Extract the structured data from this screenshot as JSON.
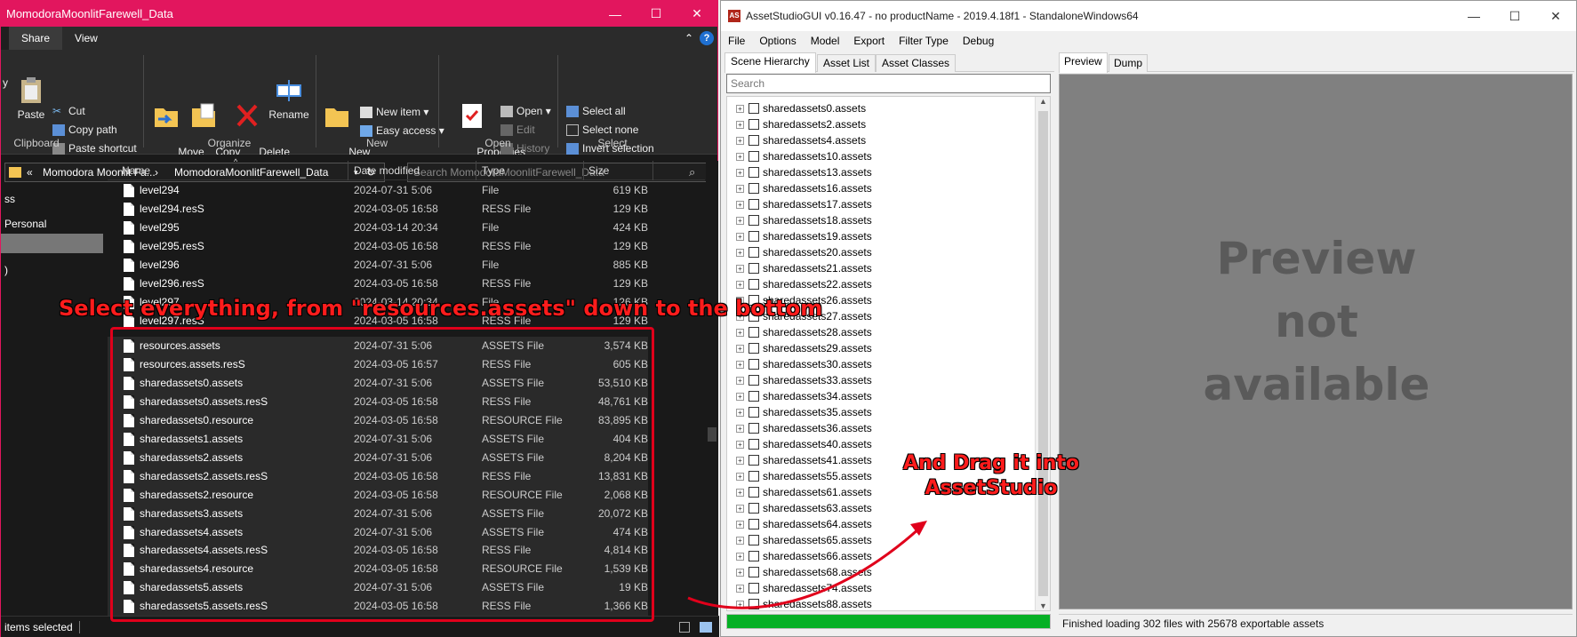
{
  "explorer": {
    "title": "MomodoraMoonlitFarewell_Data",
    "window_buttons": {
      "minimize": "—",
      "maximize": "☐",
      "close": "✕"
    },
    "tabs": [
      "Share",
      "View"
    ],
    "help": "?",
    "ribbon": {
      "clipboard": {
        "group": "Clipboard",
        "paste": "Paste",
        "cut": "Cut",
        "copy_path": "Copy path",
        "paste_shortcut": "Paste shortcut",
        "partial_left": "y"
      },
      "organize": {
        "group": "Organize",
        "move_to": "Move\nto ▾",
        "copy_to": "Copy\nto ▾",
        "delete": "Delete\n▾",
        "rename": "Rename"
      },
      "new": {
        "group": "New",
        "new_folder": "New\nfolder",
        "new_item": "New item ▾",
        "easy_access": "Easy access ▾"
      },
      "open": {
        "group": "Open",
        "properties": "Properties\n▾",
        "open": "Open ▾",
        "edit": "Edit",
        "history": "History"
      },
      "select": {
        "group": "Select",
        "select_all": "Select all",
        "select_none": "Select none",
        "invert": "Invert selection"
      }
    },
    "breadcrumb": {
      "prefix": "«",
      "part1": "Momodora Moonlit Fa...",
      "part2": "MomodoraMoonlitFarewell_Data"
    },
    "search_placeholder": "Search MomodoraMoonlitFarewell_Data",
    "nav": {
      "item1": "ss",
      "item2": "Personal",
      "item3": ")"
    },
    "columns": {
      "name": "Name",
      "date": "Date modified",
      "type": "Type",
      "size": "Size"
    },
    "files": [
      {
        "name": "level294",
        "date": "2024-07-31 5:06",
        "type": "File",
        "size": "619 KB"
      },
      {
        "name": "level294.resS",
        "date": "2024-03-05 16:58",
        "type": "RESS File",
        "size": "129 KB"
      },
      {
        "name": "level295",
        "date": "2024-03-14 20:34",
        "type": "File",
        "size": "424 KB"
      },
      {
        "name": "level295.resS",
        "date": "2024-03-05 16:58",
        "type": "RESS File",
        "size": "129 KB"
      },
      {
        "name": "level296",
        "date": "2024-07-31 5:06",
        "type": "File",
        "size": "885 KB"
      },
      {
        "name": "level296.resS",
        "date": "2024-03-05 16:58",
        "type": "RESS File",
        "size": "129 KB"
      },
      {
        "name": "level297",
        "date": "2024-03-14 20:34",
        "type": "File",
        "size": "126 KB"
      },
      {
        "name": "level297.resS",
        "date": "2024-03-05 16:58",
        "type": "RESS File",
        "size": "129 KB"
      },
      {
        "name": "resources.assets",
        "date": "2024-07-31 5:06",
        "type": "ASSETS File",
        "size": "3,574 KB"
      },
      {
        "name": "resources.assets.resS",
        "date": "2024-03-05 16:57",
        "type": "RESS File",
        "size": "605 KB"
      },
      {
        "name": "sharedassets0.assets",
        "date": "2024-07-31 5:06",
        "type": "ASSETS File",
        "size": "53,510 KB"
      },
      {
        "name": "sharedassets0.assets.resS",
        "date": "2024-03-05 16:58",
        "type": "RESS File",
        "size": "48,761 KB"
      },
      {
        "name": "sharedassets0.resource",
        "date": "2024-03-05 16:58",
        "type": "RESOURCE File",
        "size": "83,895 KB"
      },
      {
        "name": "sharedassets1.assets",
        "date": "2024-07-31 5:06",
        "type": "ASSETS File",
        "size": "404 KB"
      },
      {
        "name": "sharedassets2.assets",
        "date": "2024-07-31 5:06",
        "type": "ASSETS File",
        "size": "8,204 KB"
      },
      {
        "name": "sharedassets2.assets.resS",
        "date": "2024-03-05 16:58",
        "type": "RESS File",
        "size": "13,831 KB"
      },
      {
        "name": "sharedassets2.resource",
        "date": "2024-03-05 16:58",
        "type": "RESOURCE File",
        "size": "2,068 KB"
      },
      {
        "name": "sharedassets3.assets",
        "date": "2024-07-31 5:06",
        "type": "ASSETS File",
        "size": "20,072 KB"
      },
      {
        "name": "sharedassets4.assets",
        "date": "2024-07-31 5:06",
        "type": "ASSETS File",
        "size": "474 KB"
      },
      {
        "name": "sharedassets4.assets.resS",
        "date": "2024-03-05 16:58",
        "type": "RESS File",
        "size": "4,814 KB"
      },
      {
        "name": "sharedassets4.resource",
        "date": "2024-03-05 16:58",
        "type": "RESOURCE File",
        "size": "1,539 KB"
      },
      {
        "name": "sharedassets5.assets",
        "date": "2024-07-31 5:06",
        "type": "ASSETS File",
        "size": "19 KB"
      },
      {
        "name": "sharedassets5.assets.resS",
        "date": "2024-03-05 16:58",
        "type": "RESS File",
        "size": "1,366 KB"
      }
    ],
    "status": "items selected"
  },
  "asset_studio": {
    "title": "AssetStudioGUI v0.16.47 - no productName - 2019.4.18f1 - StandaloneWindows64",
    "logo_text": "AS",
    "menu": [
      "File",
      "Options",
      "Model",
      "Export",
      "Filter Type",
      "Debug"
    ],
    "left_tabs": [
      "Scene Hierarchy",
      "Asset List",
      "Asset Classes"
    ],
    "search_placeholder": "Search",
    "tree_items": [
      "sharedassets0.assets",
      "sharedassets2.assets",
      "sharedassets4.assets",
      "sharedassets10.assets",
      "sharedassets13.assets",
      "sharedassets16.assets",
      "sharedassets17.assets",
      "sharedassets18.assets",
      "sharedassets19.assets",
      "sharedassets20.assets",
      "sharedassets21.assets",
      "sharedassets22.assets",
      "sharedassets26.assets",
      "sharedassets27.assets",
      "sharedassets28.assets",
      "sharedassets29.assets",
      "sharedassets30.assets",
      "sharedassets33.assets",
      "sharedassets34.assets",
      "sharedassets35.assets",
      "sharedassets36.assets",
      "sharedassets40.assets",
      "sharedassets41.assets",
      "sharedassets55.assets",
      "sharedassets61.assets",
      "sharedassets63.assets",
      "sharedassets64.assets",
      "sharedassets65.assets",
      "sharedassets66.assets",
      "sharedassets68.assets",
      "sharedassets74.assets",
      "sharedassets88.assets"
    ],
    "progress": 1.0,
    "right_tabs": [
      "Preview",
      "Dump"
    ],
    "preview_message": [
      "Preview",
      "not",
      "available"
    ],
    "status": "Finished loading 302 files with 25678 exportable assets"
  },
  "annotations": {
    "select_instruction": "Select everything, from \"resources.assets\" down to the bottom",
    "drag_instruction_line1": "And Drag it into",
    "drag_instruction_line2": "AssetStudio"
  },
  "colors": {
    "explorer_accent": "#e2165e",
    "annotation_red": "#ff1c1c",
    "progress_green": "#06b025"
  }
}
